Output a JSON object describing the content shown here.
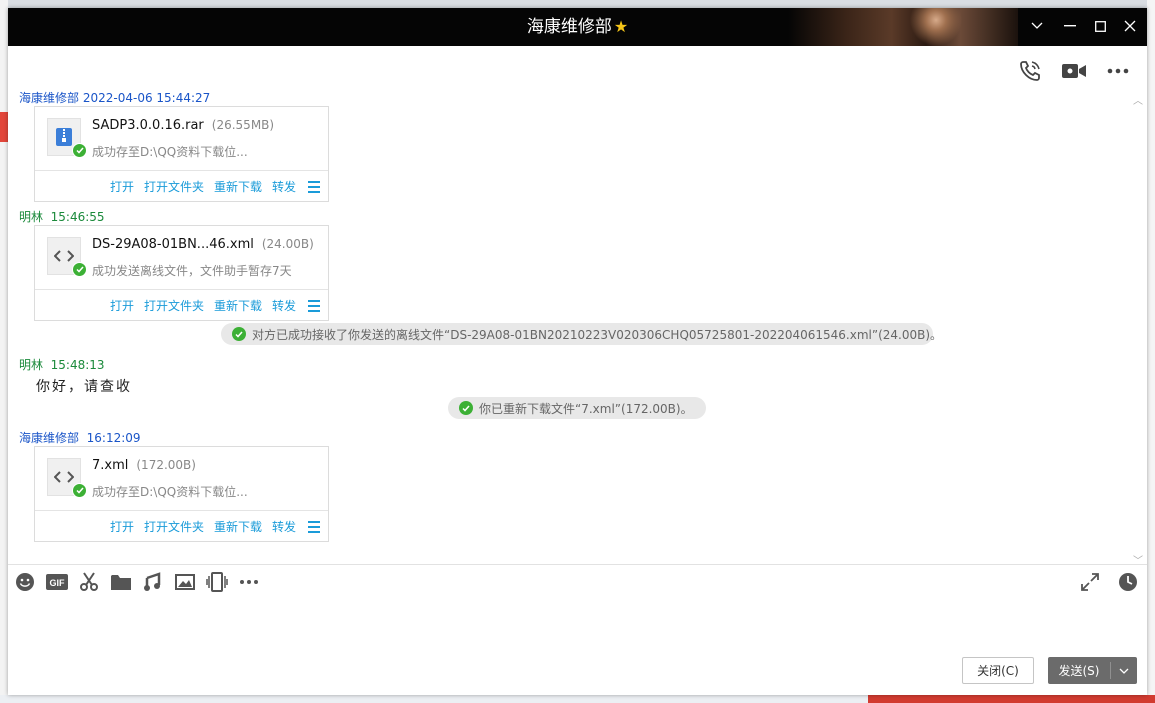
{
  "window": {
    "title": "海康维修部",
    "star": "★"
  },
  "messages": [
    {
      "sender": "海康维修部",
      "time": "2022-04-06 15:44:27",
      "file": {
        "name": "SADP3.0.0.16.rar",
        "size": "(26.55MB)",
        "status": "成功存至D:\\QQ资料下载位...",
        "icon": "archive-icon"
      }
    },
    {
      "sender": "明林",
      "time": "15:46:55",
      "file": {
        "name": "DS-29A08-01BN...46.xml",
        "size": "(24.00B)",
        "status": "成功发送离线文件，文件助手暂存7天",
        "icon": "code-file-icon"
      }
    },
    {
      "system": "对方已成功接收了你发送的离线文件“DS-29A08-01BN20210223V020306CHQ05725801-202204061546.xml”(24.00B)。"
    },
    {
      "sender": "明林",
      "time": "15:48:13",
      "text": "你好，请查收"
    },
    {
      "system": "你已重新下载文件“7.xml”(172.00B)。"
    },
    {
      "sender": "海康维修部",
      "time": "16:12:09",
      "file": {
        "name": "7.xml",
        "size": "(172.00B)",
        "status": "成功存至D:\\QQ资料下载位...",
        "icon": "code-file-icon"
      }
    }
  ],
  "file_actions": {
    "open": "打开",
    "open_folder": "打开文件夹",
    "redownload": "重新下载",
    "forward": "转发"
  },
  "buttons": {
    "close": "关闭(C)",
    "send": "发送(S)"
  },
  "colors": {
    "sender_self": "#1a55c8",
    "sender_other": "#1b8a3b",
    "action_link": "#1a9bd9",
    "success": "#3cb035",
    "send_button": "#6b6b6b"
  }
}
